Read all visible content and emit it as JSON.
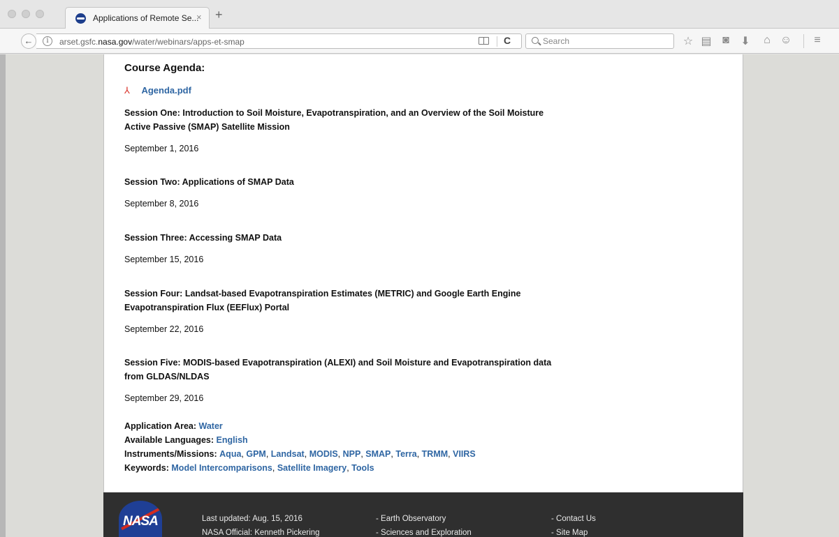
{
  "browser": {
    "tab_title": "Applications of Remote Se...",
    "tab_close": "×",
    "new_tab": "+",
    "back": "←",
    "info": "i",
    "url_prefix": "arset.gsfc.",
    "url_host": "nasa.gov",
    "url_path": "/water/webinars/apps-et-smap",
    "reload": "C",
    "search_placeholder": "Search",
    "toolbar_icons": [
      "star-icon",
      "reading-list-icon",
      "pocket-icon",
      "download-icon",
      "home-icon",
      "sync-icon",
      "menu-icon"
    ]
  },
  "page": {
    "agenda_title": "Course Agenda:",
    "agenda_link": "Agenda.pdf",
    "sessions": [
      {
        "title": "Session One: Introduction to Soil Moisture, Evapotranspiration, and an Overview of the Soil Moisture Active Passive (SMAP) Satellite Mission",
        "date": "September 1, 2016"
      },
      {
        "title": "Session Two: Applications of SMAP Data",
        "date": "September 8, 2016"
      },
      {
        "title": "Session Three: Accessing SMAP Data",
        "date": "September 15, 2016"
      },
      {
        "title": "Session Four: Landsat-based Evapotranspiration Estimates (METRIC) and Google Earth Engine Evapotranspiration Flux (EEFlux) Portal",
        "date": "September 22, 2016"
      },
      {
        "title": "Session Five: MODIS-based Evapotranspiration (ALEXI) and Soil Moisture and Evapotranspiration data from GLDAS/NLDAS",
        "date": "September 29, 2016"
      }
    ],
    "meta": {
      "application_area_label": "Application Area:",
      "application_area": "Water",
      "languages_label": "Available Languages:",
      "languages": "English",
      "instruments_label": "Instruments/Missions:",
      "instruments": [
        "Aqua",
        "GPM",
        "Landsat",
        "MODIS",
        "NPP",
        "SMAP",
        "Terra",
        "TRMM",
        "VIIRS"
      ],
      "keywords_label": "Keywords:",
      "keywords": [
        "Model Intercomparisons",
        "Satellite Imagery",
        "Tools"
      ]
    }
  },
  "footer": {
    "logo_text": "NASA",
    "col1": [
      "Last updated: Aug. 15, 2016",
      "NASA Official: Kenneth Pickering"
    ],
    "col2": [
      "- Earth Observatory",
      "- Sciences and Exploration"
    ],
    "col3": [
      "- Contact Us",
      "- Site Map"
    ]
  },
  "colors": {
    "link": "#2f66a3",
    "pdf_icon": "#d9342b",
    "footer_bg": "#2f2f2f",
    "nasa_blue": "#1f3f95",
    "nasa_red": "#d52b1e"
  }
}
